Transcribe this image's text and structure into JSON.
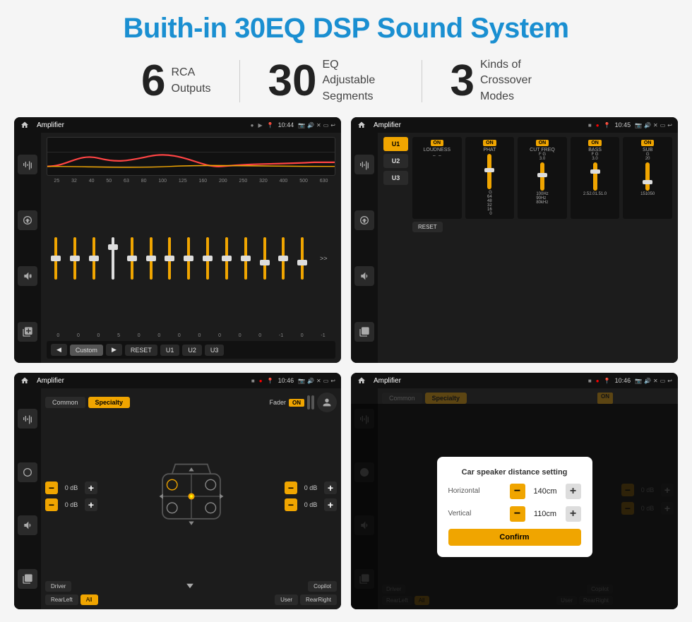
{
  "title": "Buith-in 30EQ DSP Sound System",
  "features": [
    {
      "number": "6",
      "text": "RCA\nOutputs"
    },
    {
      "number": "30",
      "text": "EQ Adjustable\nSegments"
    },
    {
      "number": "3",
      "text": "Kinds of\nCrossover Modes"
    }
  ],
  "screens": {
    "eq": {
      "status": {
        "title": "Amplifier",
        "time": "10:44"
      },
      "freqs": [
        "25",
        "32",
        "40",
        "50",
        "63",
        "80",
        "100",
        "125",
        "160",
        "200",
        "250",
        "320",
        "400",
        "500",
        "630"
      ],
      "values": [
        "0",
        "0",
        "0",
        "5",
        "0",
        "0",
        "0",
        "0",
        "0",
        "0",
        "0",
        "-1",
        "0",
        "-1"
      ],
      "preset": "Custom",
      "buttons": [
        "RESET",
        "U1",
        "U2",
        "U3"
      ]
    },
    "crossover": {
      "status": {
        "title": "Amplifier",
        "time": "10:45"
      },
      "presets": [
        "U1",
        "U2",
        "U3"
      ],
      "controls": [
        "LOUDNESS",
        "PHAT",
        "CUT FREQ",
        "BASS",
        "SUB"
      ],
      "reset": "RESET"
    },
    "fader": {
      "status": {
        "title": "Amplifier",
        "time": "10:46"
      },
      "tabs": [
        "Common",
        "Specialty"
      ],
      "activeTab": "Specialty",
      "faderLabel": "Fader",
      "onLabel": "ON",
      "volumes": [
        "0 dB",
        "0 dB",
        "0 dB",
        "0 dB"
      ],
      "bottomButtons": [
        "Driver",
        "RearLeft",
        "All",
        "User",
        "RearRight",
        "Copilot"
      ]
    },
    "dialog": {
      "status": {
        "title": "Amplifier",
        "time": "10:46"
      },
      "tabs": [
        "Common",
        "Specialty"
      ],
      "title": "Car speaker distance setting",
      "horizontal": {
        "label": "Horizontal",
        "value": "140cm"
      },
      "vertical": {
        "label": "Vertical",
        "value": "110cm"
      },
      "confirm": "Confirm",
      "bottomButtons": [
        "Driver",
        "RearLeft",
        "All",
        "User",
        "RearRight",
        "Copilot"
      ]
    }
  }
}
